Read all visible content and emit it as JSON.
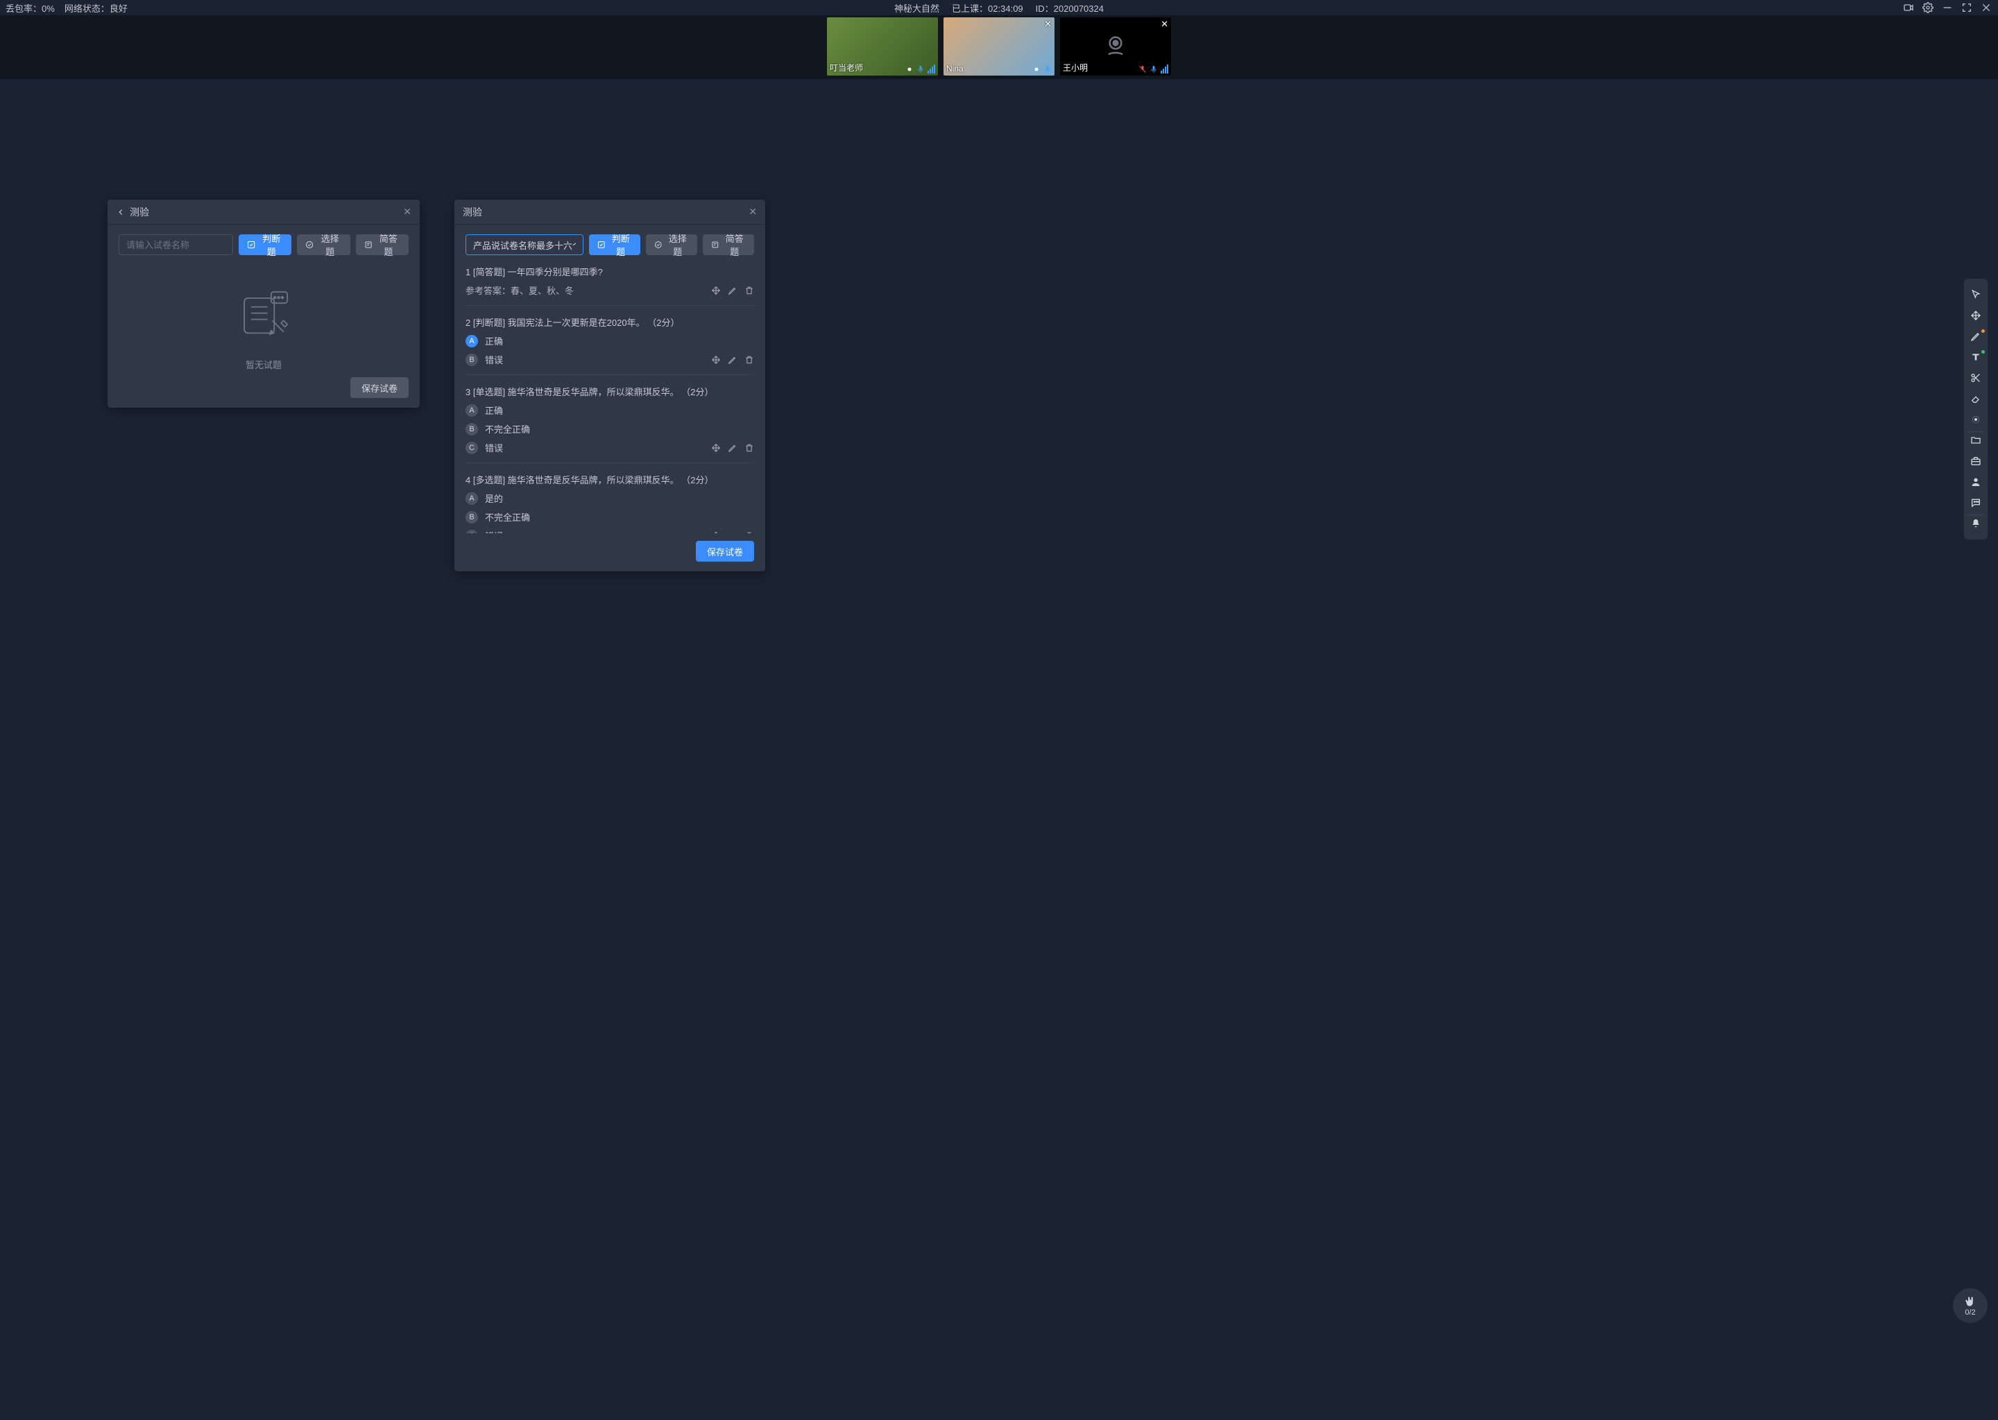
{
  "topbar": {
    "packet_loss_label": "丢包率：",
    "packet_loss_value": "0%",
    "network_label": "网络状态：",
    "network_value": "良好",
    "course_title": "神秘大自然",
    "elapsed_label": "已上课：",
    "elapsed_value": "02:34:09",
    "id_label": "ID：",
    "id_value": "2020070324"
  },
  "videos": [
    {
      "name": "叮当老师",
      "has_close": false,
      "camera_off": false
    },
    {
      "name": "Nina",
      "has_close": true,
      "camera_off": false
    },
    {
      "name": "王小明",
      "has_close": true,
      "camera_off": true
    }
  ],
  "panel_left": {
    "title": "测验",
    "name_placeholder": "请输入试卷名称",
    "btn_judge": "判断题",
    "btn_choice": "选择题",
    "btn_short": "简答题",
    "empty_text": "暂无试题",
    "save_label": "保存试卷"
  },
  "panel_right": {
    "title": "测验",
    "name_value": "产品说试卷名称最多十六个字",
    "btn_judge": "判断题",
    "btn_choice": "选择题",
    "btn_short": "简答题",
    "save_label": "保存试卷",
    "answer_prefix": "参考答案：",
    "questions": [
      {
        "index": "1",
        "tag": "[简答题]",
        "text": "一年四季分别是哪四季?",
        "answer": "春、夏、秋、冬",
        "options": []
      },
      {
        "index": "2",
        "tag": "[判断题]",
        "text": "我国宪法上一次更新是在2020年。",
        "points": "（2分）",
        "options": [
          {
            "k": "A",
            "label": "正确",
            "selected": true
          },
          {
            "k": "B",
            "label": "错误",
            "selected": false
          }
        ]
      },
      {
        "index": "3",
        "tag": "[单选题]",
        "text": "施华洛世奇是反华品牌，所以梁鼎琪反华。",
        "points": "（2分）",
        "options": [
          {
            "k": "A",
            "label": "正确",
            "selected": false
          },
          {
            "k": "B",
            "label": "不完全正确",
            "selected": false
          },
          {
            "k": "C",
            "label": "错误",
            "selected": false
          }
        ]
      },
      {
        "index": "4",
        "tag": "[多选题]",
        "text": "施华洛世奇是反华品牌，所以梁鼎琪反华。",
        "points": "（2分）",
        "options": [
          {
            "k": "A",
            "label": "是的",
            "selected": false
          },
          {
            "k": "B",
            "label": "不完全正确",
            "selected": false
          },
          {
            "k": "C",
            "label": "错误",
            "selected": false
          }
        ]
      }
    ]
  },
  "hand_counter": "0/2"
}
